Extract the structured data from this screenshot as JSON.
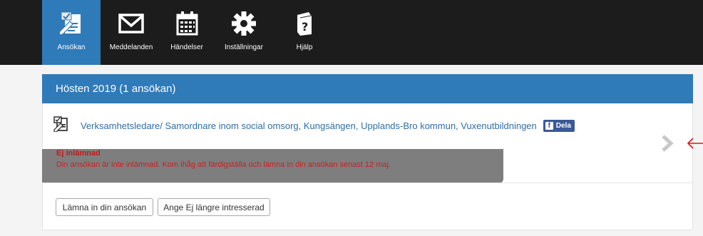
{
  "nav": {
    "items": [
      {
        "label": "Ansökan",
        "icon": "application-edit-icon",
        "active": true
      },
      {
        "label": "Meddelanden",
        "icon": "envelope-icon",
        "active": false
      },
      {
        "label": "Händelser",
        "icon": "calendar-icon",
        "active": false
      },
      {
        "label": "Inställningar",
        "icon": "gear-icon",
        "active": false
      },
      {
        "label": "Hjälp",
        "icon": "help-book-icon",
        "active": false
      }
    ]
  },
  "panel": {
    "title": "Hösten 2019 (1 ansökan)",
    "job_title": "Verksamhetsledare/ Samordnare inom social omsorg, Kungsängen, Upplands-Bro kommun, Vuxenutbildningen",
    "share_label": "Dela",
    "share_icon_letter": "f",
    "notice_title": "Ej inlämnad",
    "notice_text": "Din ansökan är inte inlämnad. Kom ihåg att färdigställa och lämna in din ansökan senast 12 maj."
  },
  "actions": {
    "submit_label": "Lämna in din ansökan",
    "not_interested_label": "Ange Ej längre intresserad"
  },
  "colors": {
    "accent": "#2f7ab8",
    "topbar": "#1c1c1c",
    "notice_text": "#d01f1f",
    "facebook": "#3b5998"
  }
}
